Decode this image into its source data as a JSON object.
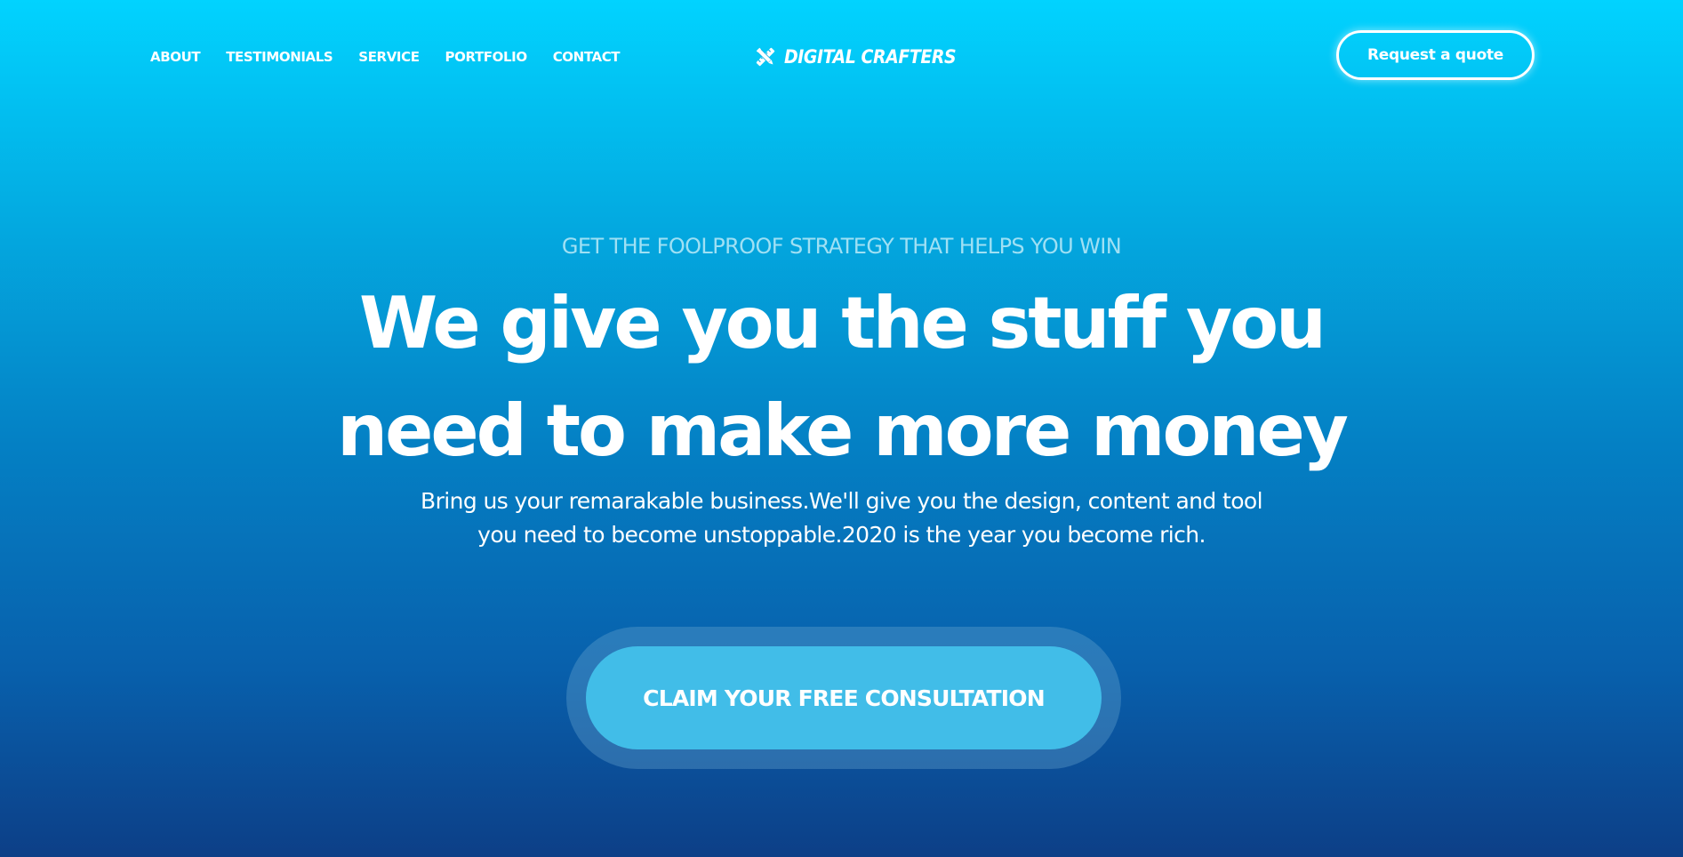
{
  "nav": {
    "items": [
      {
        "label": "ABOUT"
      },
      {
        "label": "TESTIMONIALS"
      },
      {
        "label": "SERVICE"
      },
      {
        "label": "PORTFOLIO"
      },
      {
        "label": "CONTACT"
      }
    ]
  },
  "brand": {
    "name": "DIGITAL CRAFTERS",
    "icon": "crossed-pencil-ruler-icon"
  },
  "header": {
    "quote_button": "Request a quote"
  },
  "hero": {
    "eyebrow": "GET THE FOOLPROOF STRATEGY THAT HELPS YOU WIN",
    "headline_line1": "We give you the stuff you",
    "headline_line2": "need to make more money",
    "subtext_line1": "Bring us your remarakable business.We'll give you the design, content and tool",
    "subtext_line2": "you need to become unstoppable.2020 is the year you become rich.",
    "cta": "CLAIM YOUR FREE CONSULTATION"
  },
  "colors": {
    "gradient_top": "#01d3ff",
    "gradient_bottom": "#0d3f87",
    "cta_fill": "#41bde8",
    "eyebrow_text": "#9fe0f4",
    "text": "#ffffff"
  }
}
